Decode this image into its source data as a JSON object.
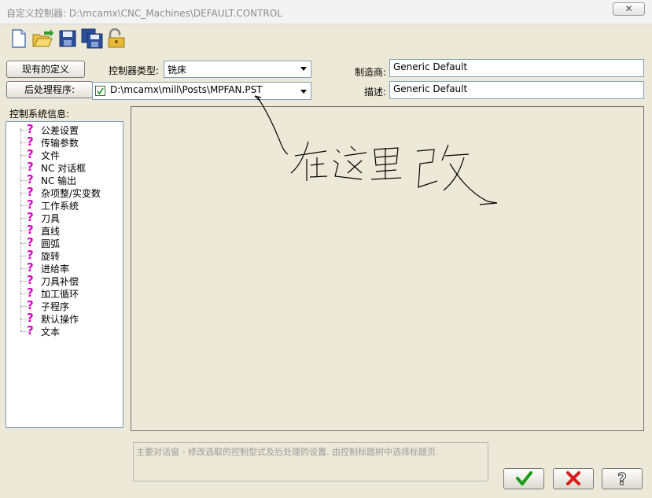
{
  "window": {
    "title": "自定义控制器: D:\\mcamx\\CNC_Machines\\DEFAULT.CONTROL",
    "close_symbol": "✕"
  },
  "toolbar": {
    "icons": [
      "new-file-icon",
      "open-folder-icon",
      "save-icon",
      "save-as-icon",
      "lock-icon"
    ]
  },
  "buttons": {
    "existing_definitions": "现有的定义",
    "post_processor": "后处理程序:"
  },
  "controller_type": {
    "label": "控制器类型:",
    "value": "铣床"
  },
  "post_file": {
    "value": "D:\\mcamx\\mill\\Posts\\MPFAN.PST"
  },
  "manufacturer": {
    "label": "制造商:",
    "value": "Generic Default"
  },
  "description": {
    "label": "描述:",
    "value": "Generic Default"
  },
  "tree": {
    "label": "控制系统信息:",
    "items": [
      "公差设置",
      "传输参数",
      "文件",
      "NC 对话框",
      "NC 输出",
      "杂项整/实变数",
      "工作系统",
      "刀具",
      "直线",
      "圆弧",
      "旋转",
      "进给率",
      "刀具补偿",
      "加工循环",
      "子程序",
      "默认操作",
      "文本"
    ]
  },
  "status_text": "主要对话窗 - 修改选取的控制型式及后处理的设置. 由控制标题树中选择标题页.",
  "action_buttons": {
    "ok": "check-icon",
    "cancel": "x-icon",
    "help": "question-icon"
  },
  "annotation": {
    "handwritten_text": "在这里改"
  },
  "colors": {
    "question_mark": "#e000c8",
    "ok_green": "#1a9a1a",
    "cancel_red": "#d81b1b"
  }
}
